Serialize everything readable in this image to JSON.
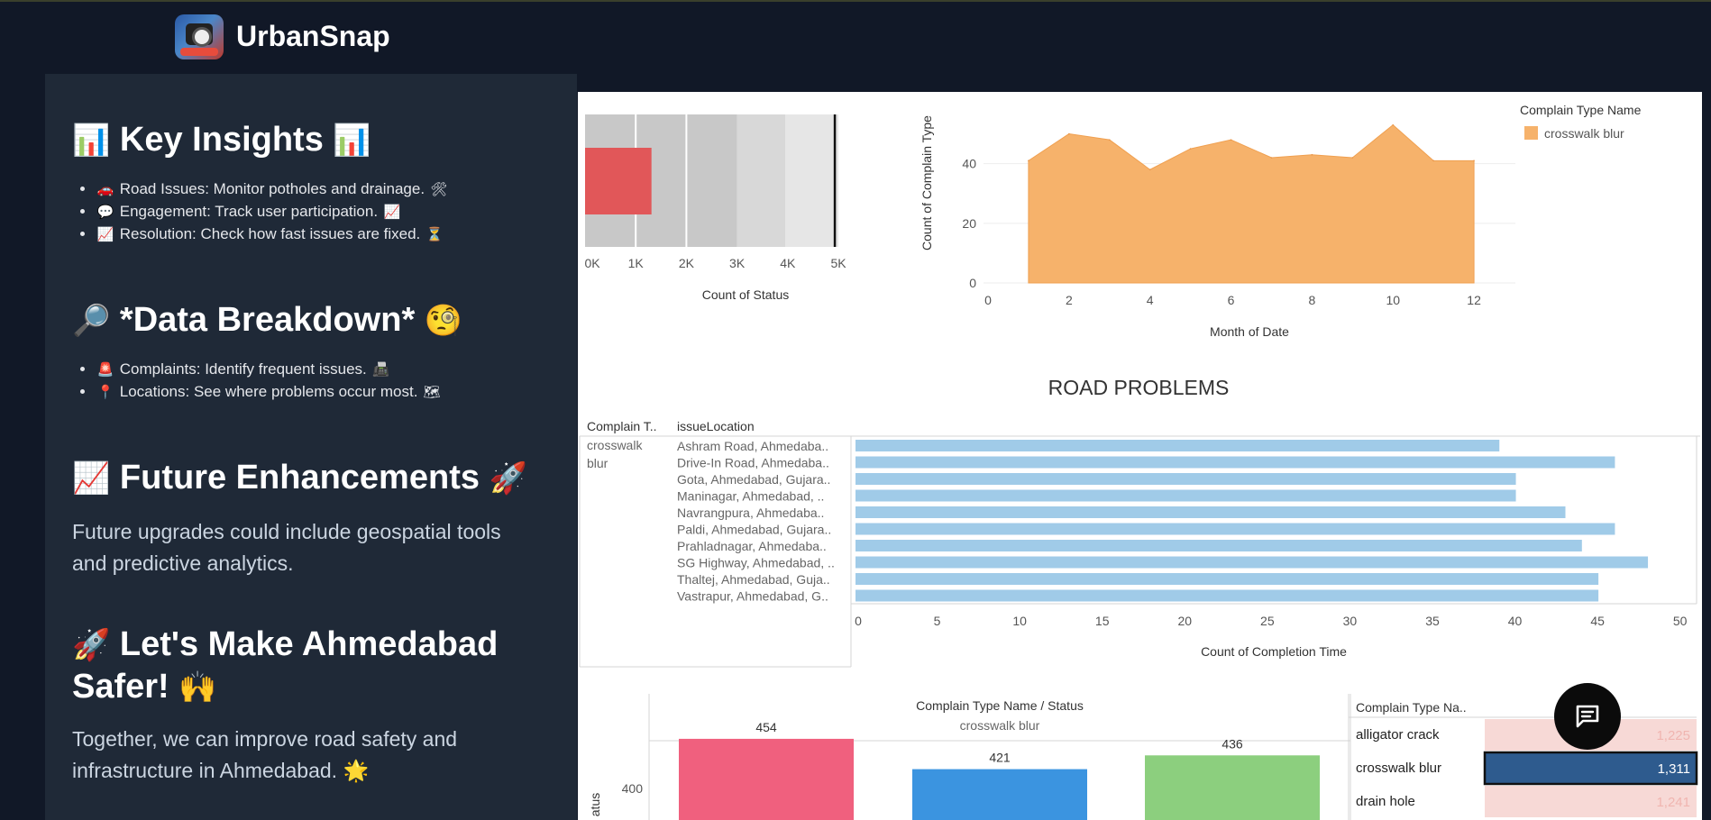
{
  "header": {
    "brand": "UrbanSnap",
    "logo_text": "URBAN SNAP"
  },
  "left_panel": {
    "key_insights": {
      "title": "Key Insights",
      "icon_left": "bar-chart-icon",
      "icon_right": "bar-chart-icon",
      "items": [
        {
          "icon": "🚗",
          "text": "Road Issues: Monitor potholes and drainage.",
          "trail": "🛠"
        },
        {
          "icon": "💬",
          "text": "Engagement: Track user participation.",
          "trail": "📈"
        },
        {
          "icon": "📈",
          "text": "Resolution: Check how fast issues are fixed.",
          "trail": "⏳"
        }
      ]
    },
    "data_breakdown": {
      "title": "*Data Breakdown*",
      "icon_left": "🔎",
      "icon_right": "🧐",
      "items": [
        {
          "icon": "🚨",
          "text": "Complaints: Identify frequent issues.",
          "trail": "📠"
        },
        {
          "icon": "📍",
          "text": "Locations: See where problems occur most.",
          "trail": "🗺"
        }
      ]
    },
    "future": {
      "title": "Future Enhancements",
      "icon_left": "📈",
      "icon_right": "🚀",
      "text": "Future upgrades could include geospatial tools and predictive analytics."
    },
    "safer": {
      "title": "Let's Make Ahmedabad Safer!",
      "icon_left": "🚀",
      "icon_right": "🙌",
      "text": "Together, we can improve road safety and infrastructure in Ahmedabad.",
      "trail": "🌟"
    }
  },
  "dashboard": {
    "section_title": "ROAD PROBLEMS",
    "colors": {
      "bullet_bar": "#e15759",
      "area": "#f6b26b",
      "hbar": "#a0cbe8",
      "col1": "#f0607e",
      "col2": "#3b94e0",
      "col3": "#8ccf7e",
      "heat_sel": "#2e5b8e",
      "heat_light": "#f7d9d6"
    }
  },
  "chart_data": [
    {
      "type": "bar",
      "xlabel": "Count of Status",
      "x_ticks": [
        "0K",
        "1K",
        "2K",
        "3K",
        "4K",
        "5K"
      ],
      "values": [
        1311
      ],
      "reference_band_ranges": [
        3000,
        3950
      ],
      "reference_line": 4930,
      "xlim": [
        0,
        5000
      ]
    },
    {
      "type": "area",
      "xlabel": "Month of Date",
      "ylabel": "Count of Complain Type",
      "legend_title": "Complain Type Name",
      "legend": [
        "crosswalk blur"
      ],
      "x_ticks": [
        "0",
        "2",
        "4",
        "6",
        "8",
        "10",
        "12"
      ],
      "y_ticks": [
        "0",
        "20",
        "40"
      ],
      "x": [
        1,
        2,
        3,
        4,
        5,
        6,
        7,
        8,
        9,
        10,
        11,
        12
      ],
      "values": [
        41,
        50,
        48,
        38,
        45,
        48,
        42,
        43,
        42,
        53,
        41,
        41
      ],
      "xlim": [
        0,
        13
      ],
      "ylim": [
        0,
        55
      ]
    },
    {
      "type": "bar",
      "orientation": "horizontal",
      "col_headers": [
        "Complain T..",
        "issueLocation"
      ],
      "group": "crosswalk blur",
      "categories": [
        "Ashram Road, Ahmedaba..",
        "Drive-In Road, Ahmedaba..",
        "Gota, Ahmedabad, Gujara..",
        "Maninagar, Ahmedabad, ..",
        "Navrangpura, Ahmedaba..",
        "Paldi, Ahmedabad, Gujara..",
        "Prahladnagar, Ahmedaba..",
        "SG Highway, Ahmedabad, ..",
        "Thaltej, Ahmedabad, Guja..",
        "Vastrapur, Ahmedabad, G.."
      ],
      "values": [
        39,
        46,
        40,
        40,
        43,
        46,
        44,
        48,
        45,
        45
      ],
      "xlabel": "Count of Completion Time",
      "x_ticks": [
        "0",
        "5",
        "10",
        "15",
        "20",
        "25",
        "30",
        "35",
        "40",
        "45",
        "50"
      ],
      "xlim": [
        0,
        51
      ]
    },
    {
      "type": "bar",
      "title": "Complain Type Name / Status",
      "subtitle": "crosswalk blur",
      "ylabel": "atus",
      "y_ticks": [
        "400"
      ],
      "values": [
        454,
        421,
        436
      ]
    },
    {
      "type": "heatmap",
      "header": "Complain Type Na..",
      "rows": [
        "alligator crack",
        "crosswalk blur",
        "drain hole"
      ],
      "values": [
        "1,225",
        "1,311",
        "1,241"
      ],
      "selected": "crosswalk blur"
    }
  ]
}
